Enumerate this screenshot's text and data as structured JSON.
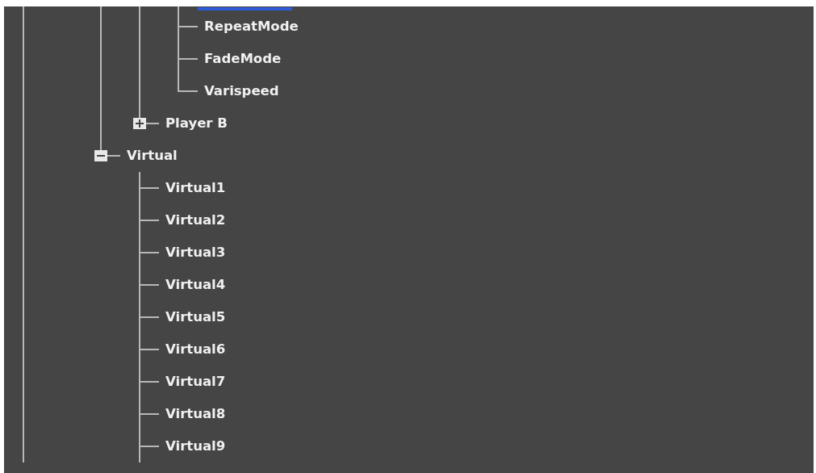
{
  "tree": [
    {
      "continues": true,
      "children": [
        {
          "children": [
            {
              "children": [
                {
                  "expanded": true,
                  "children": [
                    {
                      "selected": true
                    },
                    {
                      "label": "RepeatMode",
                      "selected": false
                    },
                    {
                      "label": "FadeMode",
                      "selected": false
                    },
                    {
                      "label": "Varispeed",
                      "selected": false
                    }
                  ]
                },
                {
                  "label": "Player B",
                  "expanded": false,
                  "selected": false
                }
              ]
            },
            {
              "label": "Virtual",
              "expanded": true,
              "selected": false,
              "children": [
                {
                  "label": "Virtual1",
                  "selected": false
                },
                {
                  "label": "Virtual2",
                  "selected": false
                },
                {
                  "label": "Virtual3",
                  "selected": false
                },
                {
                  "label": "Virtual4",
                  "selected": false
                },
                {
                  "label": "Virtual5",
                  "selected": false
                },
                {
                  "label": "Virtual6",
                  "selected": false
                },
                {
                  "label": "Virtual7",
                  "selected": false
                },
                {
                  "label": "Virtual8",
                  "selected": false
                },
                {
                  "label": "Virtual9",
                  "selected": false,
                  "continues": true
                }
              ]
            }
          ]
        }
      ]
    }
  ]
}
